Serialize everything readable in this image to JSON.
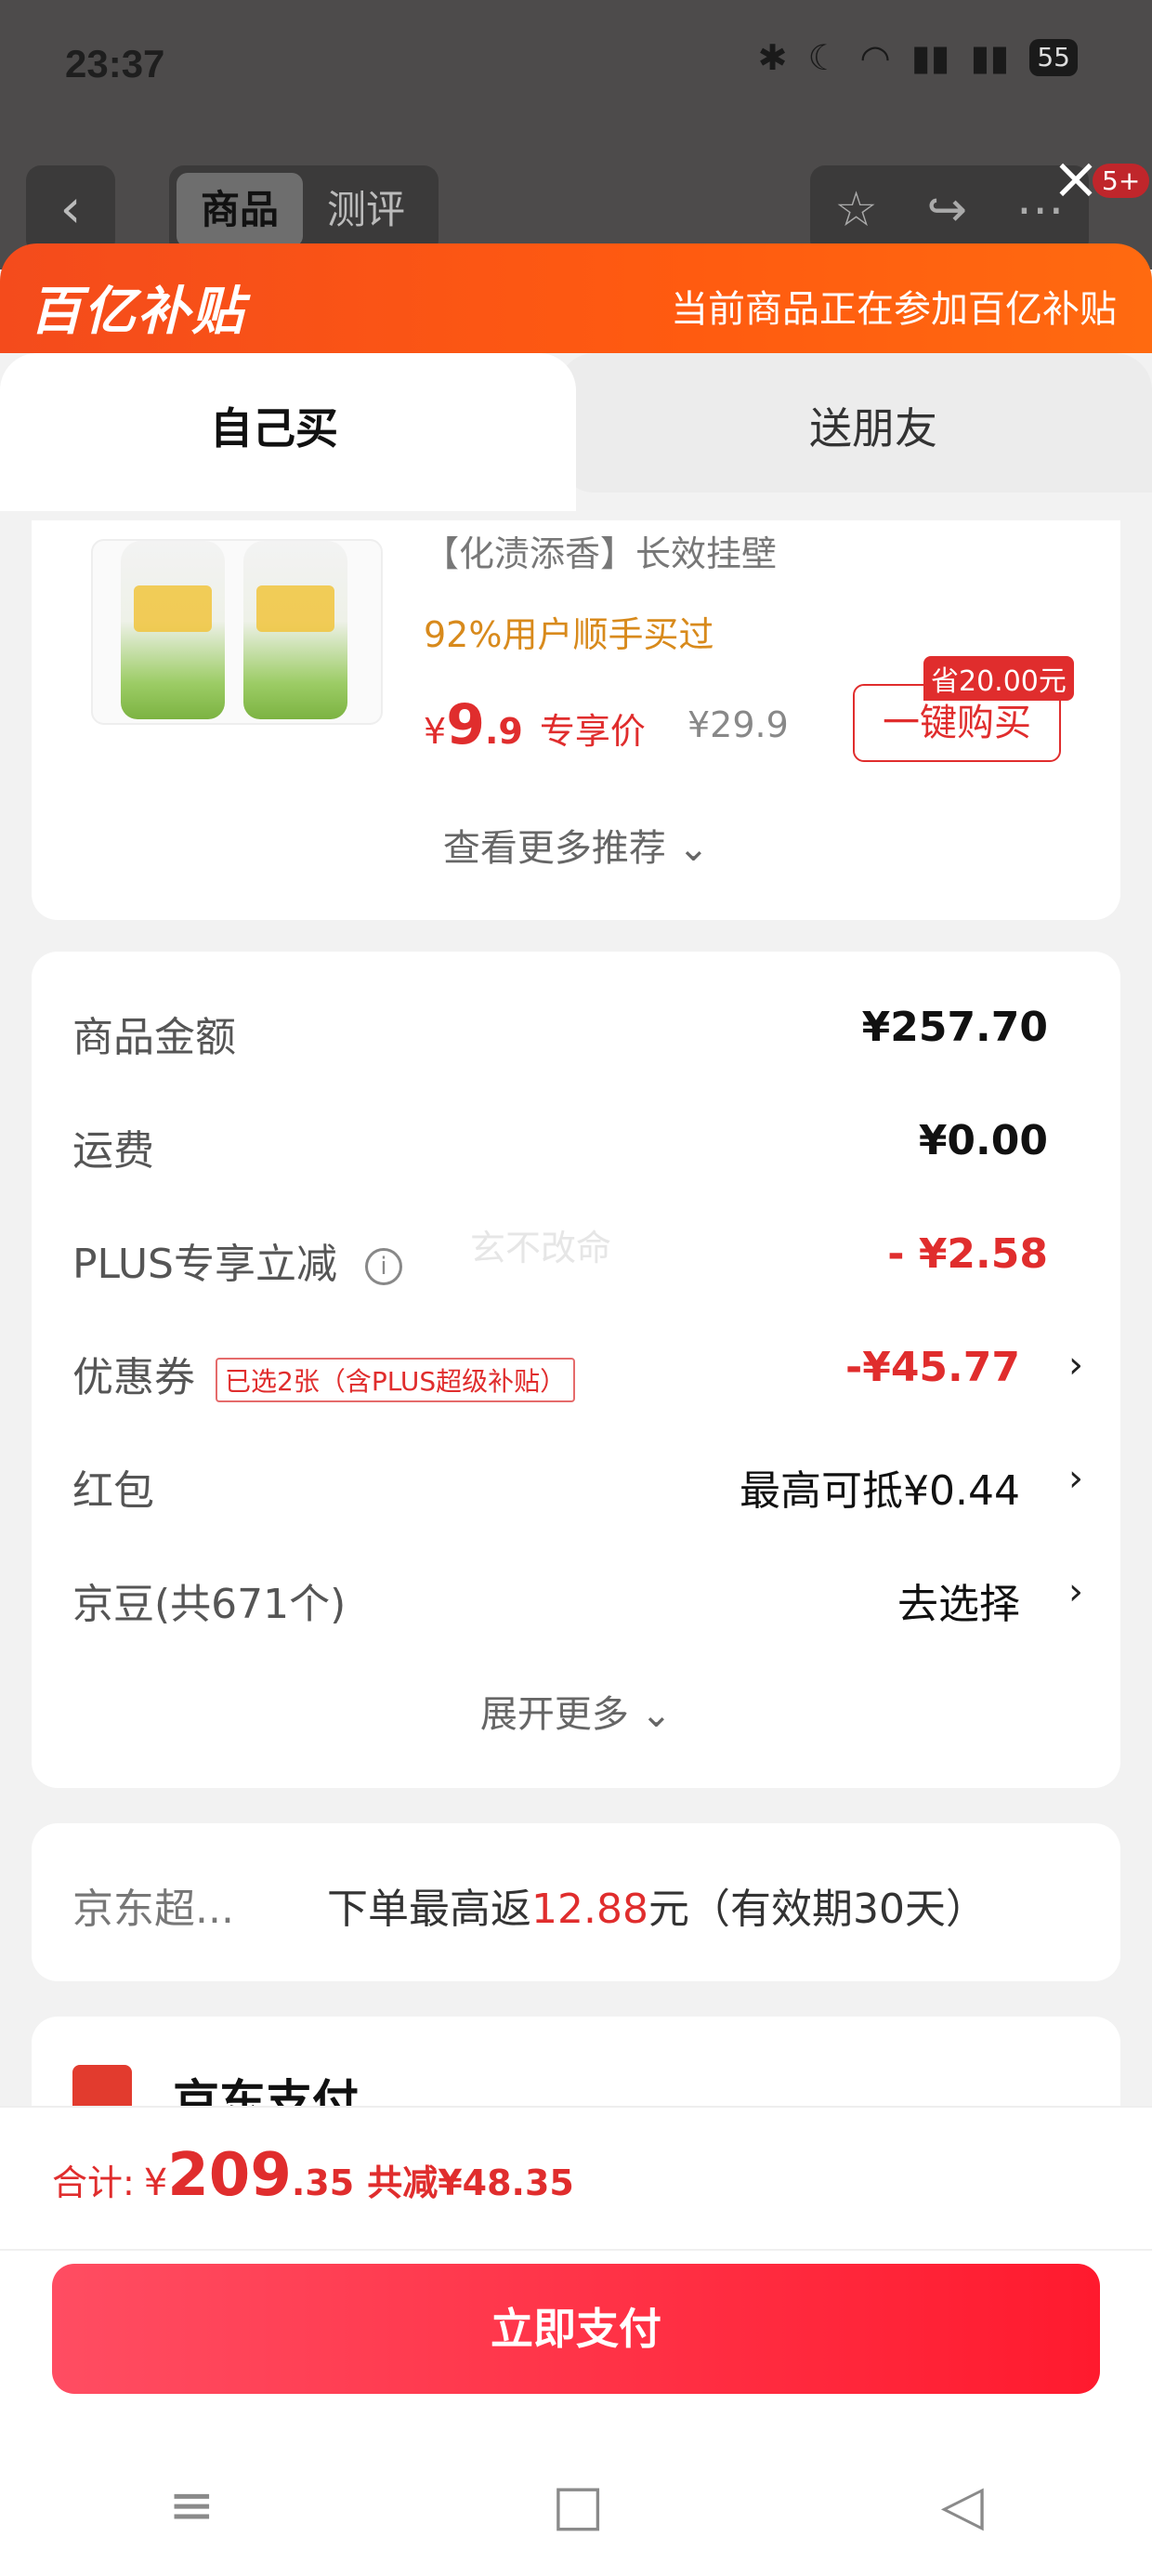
{
  "status_bar": {
    "time": "23:37",
    "icons": [
      "bluetooth-icon",
      "moon-icon",
      "wifi-icon",
      "signal-5g-icon",
      "signal-5g-icon",
      "battery-icon"
    ],
    "battery": "55"
  },
  "top_nav": {
    "back_icon": "chevron-left-icon",
    "tabs": [
      {
        "label": "商品",
        "active": true
      },
      {
        "label": "测评",
        "active": false
      }
    ],
    "actions": [
      "star-icon",
      "share-icon",
      "more-icon"
    ],
    "badge": "5+",
    "close_icon": "close-icon"
  },
  "banner": {
    "logo_text": "百亿补贴",
    "message": "当前商品正在参加百亿补贴",
    "color": "#ff5b10"
  },
  "mode_tabs": [
    {
      "label": "自己买",
      "active": true
    },
    {
      "label": "送朋友",
      "active": false
    }
  ],
  "recommend": {
    "title": "【化渍添香】长效挂壁",
    "subtitle": "92%用户顺手买过",
    "price_symbol": "¥",
    "price_int": "9",
    "price_dec": ".9",
    "price_tag": "专享价",
    "old_price": "¥29.9",
    "save_badge": "省20.00元",
    "buy_label": "一键购买",
    "more_label": "查看更多推荐 ⌄"
  },
  "summary": {
    "rows": [
      {
        "label": "商品金额",
        "value": "¥257.70"
      },
      {
        "label": "运费",
        "value": "¥0.00"
      },
      {
        "label": "PLUS专享立减",
        "value": "- ¥2.58"
      },
      {
        "label": "优惠券",
        "tag": "已选2张（含PLUS超级补贴）",
        "value": "-¥45.77"
      },
      {
        "label": "红包",
        "value": "最高可抵¥0.44"
      },
      {
        "label": "京豆(共671个)",
        "value": "去选择"
      }
    ],
    "watermark": "玄不改命",
    "expand_label": "展开更多 ⌄"
  },
  "cashback": {
    "label": "京东超...",
    "text_prefix": "下单最高返",
    "amount": "12.88",
    "text_suffix": "元（有效期30天）"
  },
  "payment": {
    "label": "京东支付"
  },
  "footer": {
    "total_label": "合计:",
    "total_symbol": "¥",
    "total_int": "209",
    "total_dec": ".35",
    "total_save": "共减¥48.35",
    "pay_button": "立即支付"
  },
  "system_nav": [
    "menu-icon",
    "home-icon",
    "back-icon"
  ],
  "colors": {
    "accent": "#e02d2d",
    "banner": "#ff5b10"
  }
}
